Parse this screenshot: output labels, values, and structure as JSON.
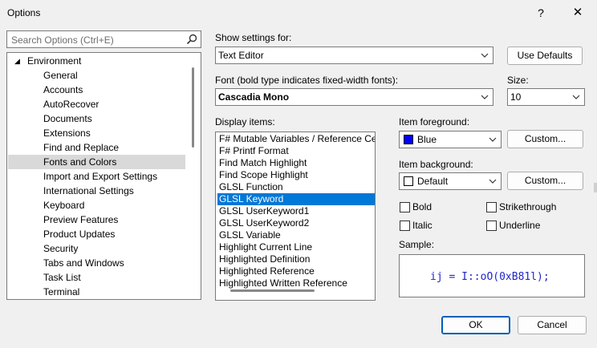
{
  "window": {
    "title": "Options",
    "help_glyph": "?",
    "close_glyph": "✕"
  },
  "search": {
    "placeholder": "Search Options (Ctrl+E)",
    "icon": "search-icon"
  },
  "tree": {
    "root_arrow": "◢",
    "root": "Environment",
    "items": [
      {
        "label": "General"
      },
      {
        "label": "Accounts"
      },
      {
        "label": "AutoRecover"
      },
      {
        "label": "Documents"
      },
      {
        "label": "Extensions"
      },
      {
        "label": "Find and Replace"
      },
      {
        "label": "Fonts and Colors",
        "selected": true
      },
      {
        "label": "Import and Export Settings"
      },
      {
        "label": "International Settings"
      },
      {
        "label": "Keyboard"
      },
      {
        "label": "Preview Features"
      },
      {
        "label": "Product Updates"
      },
      {
        "label": "Security"
      },
      {
        "label": "Tabs and Windows"
      },
      {
        "label": "Task List"
      },
      {
        "label": "Terminal"
      }
    ]
  },
  "show_settings": {
    "label": "Show settings for:",
    "value": "Text Editor",
    "use_defaults": "Use Defaults"
  },
  "font": {
    "label": "Font (bold type indicates fixed-width fonts):",
    "value": "Cascadia Mono",
    "size_label": "Size:",
    "size_value": "10"
  },
  "display_items": {
    "label": "Display items:",
    "items": [
      "F# Mutable Variables / Reference Ce",
      "F# Printf Format",
      "Find Match Highlight",
      "Find Scope Highlight",
      "GLSL Function",
      "GLSL Keyword",
      "GLSL UserKeyword1",
      "GLSL UserKeyword2",
      "GLSL Variable",
      "Highlight Current Line",
      "Highlighted Definition",
      "Highlighted Reference",
      "Highlighted Written Reference"
    ],
    "selected_index": 5
  },
  "item_foreground": {
    "label": "Item foreground:",
    "value": "Blue",
    "color": "#0000ff",
    "custom": "Custom..."
  },
  "item_background": {
    "label": "Item background:",
    "value": "Default",
    "color": "#ffffff",
    "custom": "Custom..."
  },
  "options": {
    "bold": "Bold",
    "italic": "Italic",
    "strikethrough": "Strikethrough",
    "underline": "Underline"
  },
  "sample": {
    "label": "Sample:",
    "text": "ij = I::oO(0xB81l);",
    "color": "#1f26c7"
  },
  "footer": {
    "ok": "OK",
    "cancel": "Cancel"
  },
  "accent": "#0078d7"
}
